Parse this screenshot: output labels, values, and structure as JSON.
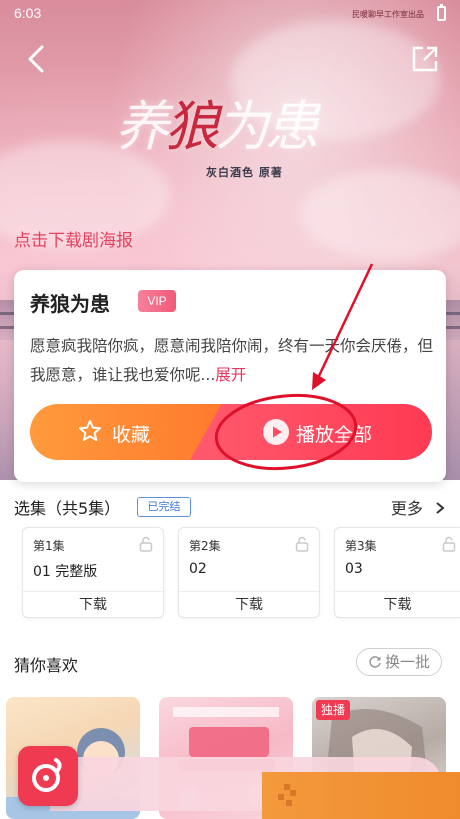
{
  "status_bar": {
    "time": "6:03",
    "studio": "民暖聊早工作室出品"
  },
  "header": {
    "back_icon": "chevron-left-icon",
    "share_icon": "share-icon"
  },
  "cover": {
    "title_left": "养",
    "title_mid": "狼",
    "title_right": "为患",
    "author": "灰白酒色 原著",
    "download_poster": "点击下载剧海报"
  },
  "book": {
    "title": "养狼为患",
    "badge": "VIP",
    "description": "愿意疯我陪你疯，愿意闹我陪你闹，终有一天你会厌倦，但我愿意，谁让我也爱你呢...",
    "expand": "展开"
  },
  "actions": {
    "collect": "收藏",
    "play_all": "播放全部"
  },
  "episodes": {
    "heading": "选集（共5集）",
    "status": "已完结",
    "more": "更多",
    "items": [
      {
        "num": "第1集",
        "name": "01 完整版",
        "download": "下载"
      },
      {
        "num": "第2集",
        "name": "02",
        "download": "下载"
      },
      {
        "num": "第3集",
        "name": "03",
        "download": "下载"
      }
    ]
  },
  "recommend": {
    "heading": "猜你喜欢",
    "refresh": "换一批",
    "badge": "独播"
  },
  "colors": {
    "accent": "#e8355b",
    "collect_orange": "#ff8a34",
    "play_red": "#ff4a5f",
    "badge_blue": "#3e77d6"
  }
}
